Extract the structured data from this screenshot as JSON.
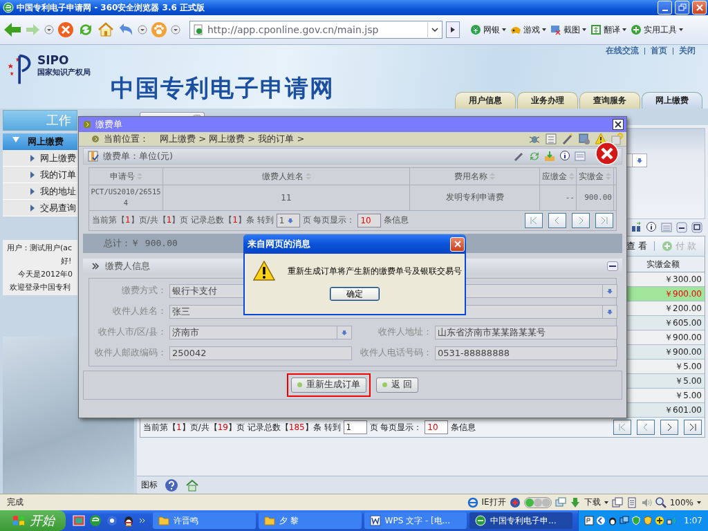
{
  "browser": {
    "title": "中国专利电子申请网 - 360安全浏览器 3.6 正式版",
    "address": "http://app.cponline.gov.cn/main.jsp",
    "tools": [
      {
        "label": "网银"
      },
      {
        "label": "游戏"
      },
      {
        "label": "截图"
      },
      {
        "label": "翻译"
      },
      {
        "label": "实用工具"
      }
    ],
    "status": "完成",
    "status_items": [
      {
        "label": "IE打开"
      },
      {
        "label": "下载"
      },
      {
        "label": "100%"
      }
    ]
  },
  "header": {
    "logo_text": "SIPO",
    "logo_subtitle": "国家知识产权局",
    "site_title": "中国专利电子申请网",
    "top_links": [
      "在线交流",
      "首页",
      "关闭"
    ],
    "tabs": [
      {
        "label": "用户信息",
        "selected": false
      },
      {
        "label": "业务办理",
        "selected": false
      },
      {
        "label": "查询服务",
        "selected": false
      },
      {
        "label": "网上缴费",
        "selected": true
      }
    ]
  },
  "sidebar": {
    "title": "工作",
    "section": {
      "label": "网上缴费",
      "expanded": true
    },
    "items": [
      "网上缴费",
      "我的订单",
      "我的地址",
      "交易查询"
    ],
    "user_lines": [
      "用户：测试用户(ac",
      "好!",
      "今天是2012年0",
      "欢迎登录中国专利"
    ]
  },
  "main": {
    "actions": [
      {
        "label": "查 看",
        "disabled": false
      },
      {
        "label": "付 款",
        "disabled": true
      }
    ],
    "column": "实缴金额",
    "rows": [
      {
        "amount": "￥300.00",
        "selected": false
      },
      {
        "amount": "￥900.00",
        "selected": true
      },
      {
        "amount": "￥200.00",
        "selected": false
      },
      {
        "amount": "￥605.00",
        "selected": false
      },
      {
        "amount": "￥900.00",
        "selected": false
      },
      {
        "amount": "￥900.00",
        "selected": false
      },
      {
        "amount": "￥5.00",
        "selected": false
      },
      {
        "amount": "￥5.00",
        "selected": false
      },
      {
        "amount": "￥5.00",
        "selected": false
      },
      {
        "amount": "￥601.00",
        "selected": false
      }
    ],
    "pager": {
      "segments": [
        {
          "text": "当前第【",
          "kind": "label"
        },
        {
          "text": "1",
          "kind": "number"
        },
        {
          "text": "】页/共【",
          "kind": "label"
        },
        {
          "text": "19",
          "kind": "number"
        },
        {
          "text": "】页 记录总数【",
          "kind": "label"
        },
        {
          "text": "185",
          "kind": "number"
        },
        {
          "text": "】条 转到",
          "kind": "label"
        }
      ],
      "goto": "1",
      "mid": "页 每页显示：",
      "page_size": "10",
      "after": "条信息"
    },
    "bottom_label": "图标"
  },
  "modal": {
    "title": "缴费单",
    "breadcrumb_label": "当前位置：",
    "breadcrumb": "网上缴费 > 网上缴费 > 我的订单 >",
    "panel_title": "缴费单：单位(元)",
    "table": {
      "columns": [
        "申请号",
        "缴费人姓名",
        "费用名称",
        "应缴金",
        "实缴金"
      ],
      "rows": [
        [
          "PCT/US2010/265154",
          "11",
          "发明专利申请费",
          "--",
          "900.00"
        ]
      ]
    },
    "pager": {
      "segments": [
        {
          "text": "当前第【",
          "kind": "label"
        },
        {
          "text": "1",
          "kind": "number"
        },
        {
          "text": "】页/共【",
          "kind": "label"
        },
        {
          "text": "1",
          "kind": "number"
        },
        {
          "text": "】页 记录总数【",
          "kind": "label"
        },
        {
          "text": "1",
          "kind": "number"
        },
        {
          "text": "】条 转到",
          "kind": "label"
        }
      ],
      "goto": "1",
      "mid": "页 每页显示：",
      "page_size": "10",
      "after": "条信息"
    },
    "total": "总计：￥ 900.00",
    "payer_section": "缴费人信息",
    "fields": [
      {
        "label": "缴费方式：",
        "value": "银行卡支付",
        "kind": "select-wide"
      },
      {
        "label": "收件人姓名：",
        "value": "张三",
        "kind": "select-wide"
      },
      {
        "label": "收件人市/区/县：",
        "value": "济南市",
        "kind": "select"
      },
      {
        "label": "收件人地址：",
        "value": "山东省济南市某某路某某号",
        "kind": "text"
      },
      {
        "label": "收件人邮政编码：",
        "value": "250042",
        "kind": "text"
      },
      {
        "label": "收件人电话号码：",
        "value": "0531-88888888",
        "kind": "text"
      }
    ],
    "buttons": [
      {
        "label": "重新生成订单",
        "highlighted": true
      },
      {
        "label": "返 回",
        "highlighted": false
      }
    ]
  },
  "dialog": {
    "title": "来自网页的消息",
    "message": "重新生成订单将产生新的缴费单号及银联交易号",
    "button": "确定"
  },
  "taskbar": {
    "start": "开始",
    "tasks": [
      {
        "label": "许晋鸣",
        "kind": "folder",
        "selected": false
      },
      {
        "label": "夕 黎",
        "kind": "folder",
        "selected": false
      },
      {
        "label": "WPS 文字 - [电...",
        "kind": "wps",
        "selected": false
      },
      {
        "label": "中国专利电子申...",
        "kind": "browser",
        "selected": true
      }
    ],
    "clock": "1:07"
  }
}
